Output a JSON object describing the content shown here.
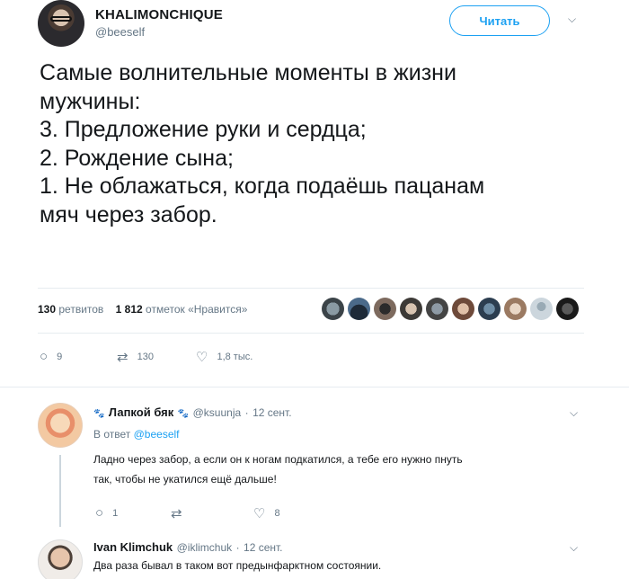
{
  "tweet": {
    "author_name": "KHALIMONCHIQUE",
    "author_handle": "@beeself",
    "follow_label": "Читать",
    "text_lines": [
      "Самые волнительные моменты в жизни",
      "мужчины:",
      "3. Предложение руки и сердца;",
      "2. Рождение сына;",
      "1. Не облажаться, когда подаёшь пацанам",
      "мяч через забор."
    ],
    "retweets_count": "130",
    "retweets_label": "ретвитов",
    "likes_count": "1 812",
    "likes_label": "отметок «Нравится»",
    "actions": {
      "reply": "9",
      "retweet": "130",
      "like": "1,8 тыс."
    }
  },
  "replies": [
    {
      "name": "Лапкой бяк",
      "handle": "@ksuunja",
      "date": "12 сент.",
      "reply_prefix": "В ответ",
      "reply_to": "@beeself",
      "text_lines": [
        "Ладно через забор, а если он к ногам подкатился, а тебе его нужно пнуть",
        "так, чтобы не укатился ещё дальше!"
      ],
      "actions": {
        "reply": "1",
        "retweet": "",
        "like": "8"
      }
    },
    {
      "name": "Ivan Klimchuk",
      "handle": "@iklimchuk",
      "date": "12 сент.",
      "text": "Два раза бывал в таком вот предынфарктном состоянии."
    }
  ],
  "colors": {
    "accent": "#1da1f2",
    "muted": "#657786",
    "text": "#14171a",
    "divider": "#e6ecf0"
  },
  "icons": [
    "reply-icon",
    "retweet-icon",
    "heart-icon",
    "chevron-down-icon",
    "paw-icon"
  ]
}
